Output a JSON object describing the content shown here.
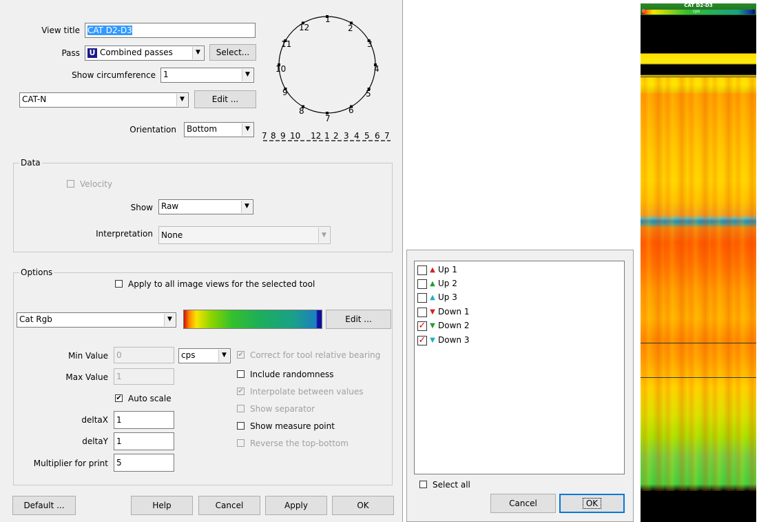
{
  "dialog": {
    "view_title_label": "View title",
    "view_title_value": "CAT D2-D3",
    "pass_label": "Pass",
    "pass_badge": "U",
    "pass_value": "Combined passes",
    "select_button": "Select...",
    "circumference_label": "Show circumference",
    "circumference_value": "1",
    "curve_value": "CAT-N",
    "edit_button": "Edit ...",
    "orientation_label": "Orientation",
    "orientation_value": "Bottom",
    "circle_labels": [
      "1",
      "2",
      "3",
      "4",
      "5",
      "6",
      "7",
      "8",
      "9",
      "10",
      "11",
      "12"
    ],
    "scale_labels": [
      "7",
      "8",
      "9",
      "10",
      "12",
      "1",
      "2",
      "3",
      "4",
      "5",
      "6",
      "7"
    ],
    "data_group": {
      "title": "Data",
      "velocity_label": "Velocity",
      "show_label": "Show",
      "show_value": "Raw",
      "interpretation_label": "Interpretation",
      "interpretation_value": "None"
    },
    "options_group": {
      "title": "Options",
      "apply_all_label": "Apply to all image views for the selected tool",
      "palette_value": "Cat Rgb",
      "palette_edit_button": "Edit ...",
      "min_label": "Min Value",
      "min_value": "0",
      "unit_value": "cps",
      "max_label": "Max Value",
      "max_value": "1",
      "auto_scale_label": "Auto scale",
      "deltax_label": "deltaX",
      "deltax_value": "1",
      "deltay_label": "deltaY",
      "deltay_value": "1",
      "multiplier_label": "Multiplier for print",
      "multiplier_value": "5",
      "correct_label": "Correct for tool relative bearing",
      "randomness_label": "Include randomness",
      "interpolate_label": "Interpolate between values",
      "separator_label": "Show separator",
      "measure_label": "Show measure point",
      "reverse_label": "Reverse the top-bottom"
    },
    "buttons": {
      "default": "Default ...",
      "help": "Help",
      "cancel": "Cancel",
      "apply": "Apply",
      "ok": "OK"
    }
  },
  "pass_popup": {
    "items": [
      {
        "label": "Up 1",
        "checked": false,
        "arrow": "▲",
        "color": "#d62020"
      },
      {
        "label": "Up 2",
        "checked": false,
        "arrow": "▲",
        "color": "#20a030"
      },
      {
        "label": "Up 3",
        "checked": false,
        "arrow": "▲",
        "color": "#20b0c0"
      },
      {
        "label": "Down 1",
        "checked": false,
        "arrow": "▼",
        "color": "#d62020"
      },
      {
        "label": "Down 2",
        "checked": true,
        "arrow": "▼",
        "color": "#20a030"
      },
      {
        "label": "Down 3",
        "checked": true,
        "arrow": "▼",
        "color": "#20b0c0"
      }
    ],
    "select_all_label": "Select all",
    "cancel_button": "Cancel",
    "ok_button": "OK"
  },
  "image_view": {
    "title": "CAT D2-D3",
    "scale_min": "0",
    "scale_unit": "cps",
    "scale_max": "1"
  }
}
